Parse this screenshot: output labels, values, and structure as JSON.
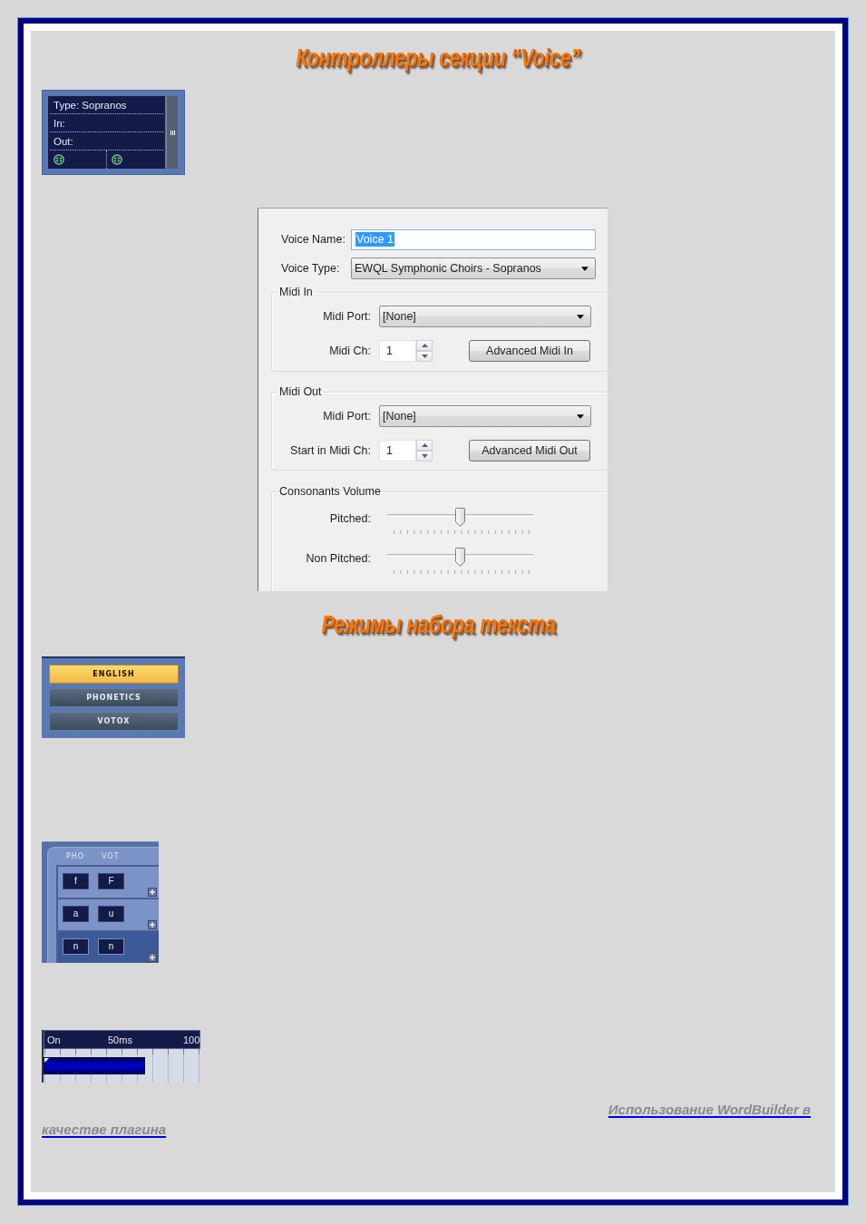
{
  "section_title_1": "Контроллеры секции “Voice”",
  "voice_strip": {
    "rows": [
      "Type: Sopranos",
      "In:",
      "Out:"
    ]
  },
  "voice_dialog": {
    "voice_name": {
      "label": "Voice Name:",
      "value": "Voice 1",
      "text_selected": true
    },
    "voice_type": {
      "label": "Voice Type:",
      "value": "EWQL Symphonic Choirs - Sopranos"
    },
    "groups": [
      {
        "title": "Midi In",
        "port_label": "Midi Port:",
        "port_value": "[None]",
        "channel_label": "Midi Ch:",
        "channel_value": "1",
        "button": "Advanced Midi In"
      },
      {
        "title": "Midi Out",
        "port_label": "Midi Port:",
        "port_value": "[None]",
        "channel_label": "Start in Midi Ch:",
        "channel_value": "1",
        "button": "Advanced Midi Out"
      }
    ],
    "consonants_volume": {
      "title": "Consonants Volume",
      "sliders": [
        {
          "label": "Pitched:",
          "level": 0.5
        },
        {
          "label": "Non Pitched:",
          "level": 0.5
        }
      ]
    }
  },
  "section_title_2": "Режимы набора текста",
  "input_modes": [
    {
      "label": "ENGLISH",
      "selected": true
    },
    {
      "label": "PHONETICS",
      "selected": false
    },
    {
      "label": "VOTOX",
      "selected": false
    }
  ],
  "phoneme_table": {
    "columns": [
      "PHO",
      "VOT"
    ],
    "rows": [
      {
        "pho": "f",
        "vot": "F",
        "selected": false
      },
      {
        "pho": "a",
        "vot": "u",
        "selected": false
      },
      {
        "pho": "n",
        "vot": "n",
        "selected": true
      }
    ]
  },
  "timing_ruler": {
    "labels": [
      "On",
      "50ms",
      "100"
    ]
  },
  "footer_link": {
    "lines": [
      "Использование WordBuilder в",
      "качестве плагина"
    ]
  }
}
